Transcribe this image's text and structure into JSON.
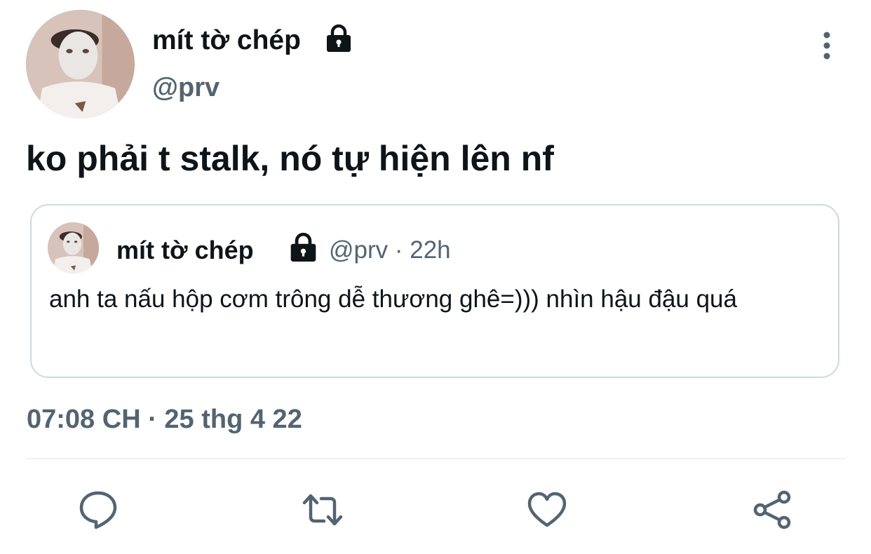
{
  "tweet": {
    "author": {
      "display_name": "mít tờ chép",
      "handle": "@prv",
      "protected_icon": "lock-icon",
      "avatar": "profile-photo"
    },
    "more_icon": "more-vertical-icon",
    "text": "ko phải t stalk, nó tự hiện lên nf",
    "timestamp": "07:08 CH · 25 thg 4 22"
  },
  "quoted_tweet": {
    "author": {
      "display_name": "mít tờ chép",
      "handle_time": "@prv · 22h",
      "protected_icon": "lock-icon",
      "avatar": "profile-photo"
    },
    "text": "anh ta nấu hộp cơm trông dễ thương ghê=))) nhìn hậu đậu quá"
  },
  "actions": [
    {
      "icon": "reply-icon"
    },
    {
      "icon": "retweet-icon"
    },
    {
      "icon": "like-icon"
    },
    {
      "icon": "share-icon"
    }
  ],
  "colors": {
    "text_primary": "#0f1419",
    "text_secondary": "#536471",
    "border": "#cfd9de",
    "divider": "#eff3f4"
  }
}
